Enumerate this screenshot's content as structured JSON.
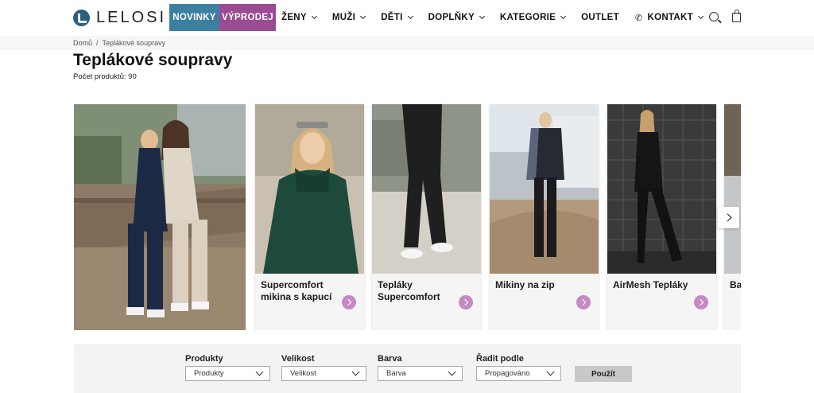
{
  "logo": {
    "text": "LELOSI"
  },
  "nav": {
    "items": [
      {
        "label": "NOVINKY"
      },
      {
        "label": "VÝPRODEJ"
      },
      {
        "label": "ŽENY"
      },
      {
        "label": "MUŽI"
      },
      {
        "label": "DĚTI"
      },
      {
        "label": "DOPLŇKY"
      },
      {
        "label": "KATEGORIE"
      },
      {
        "label": "OUTLET"
      },
      {
        "label": "KONTAKT"
      }
    ],
    "phone_glyph": "✆"
  },
  "breadcrumb": {
    "home": "Domů",
    "separator": "/",
    "current": "Teplákové soupravy"
  },
  "page": {
    "title": "Teplákové soupravy",
    "count": "Počet produktů: 90"
  },
  "categories": [
    {
      "label": "Supercomfort mikina s kapucí"
    },
    {
      "label": "Tepláky Supercomfort"
    },
    {
      "label": "Mikiny na zip"
    },
    {
      "label": "AirMesh Tepláky"
    },
    {
      "label": "Ba"
    }
  ],
  "filters": {
    "products": {
      "label": "Produkty",
      "value": "Produkty"
    },
    "size": {
      "label": "Velikost",
      "value": "Velikost"
    },
    "color": {
      "label": "Barva",
      "value": "Barva"
    },
    "sort": {
      "label": "Řadit podle",
      "value": "Propagováno"
    },
    "apply_label": "Použít"
  },
  "colors": {
    "novinky": "#3c7fa0",
    "vyprodej": "#9a4b93",
    "arrow_accent": "#c58ac3"
  }
}
